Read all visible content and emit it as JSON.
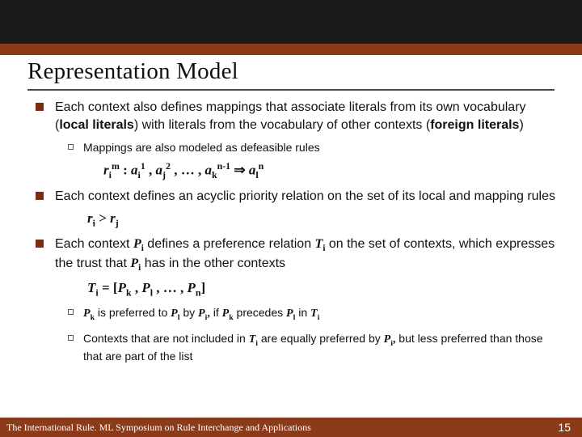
{
  "title": "Representation Model",
  "bullets": {
    "b1a": "Each context also defines mappings that associate literals from its own vocabulary (",
    "b1b": "local literals",
    "b1c": ") with literals from the vocabulary of other contexts (",
    "b1d": "foreign literals",
    "b1e": ")",
    "sub1": "Mappings are also modeled as defeasible rules",
    "b2": "Each context defines an acyclic priority relation on the set of its local and mapping rules",
    "b3a": "Each context ",
    "b3b": " defines a preference relation ",
    "b3c": " on the set of contexts, which expresses the trust that ",
    "b3d": " has in the other contexts",
    "sub2a": " is preferred to ",
    "sub2b": " by ",
    "sub2c": " if ",
    "sub2d": " precedes ",
    "sub2e": " in ",
    "sub3a": "Contexts that are not included in ",
    "sub3b": " are equally preferred by ",
    "sub3c": " but less preferred than those that are part of the list"
  },
  "sym": {
    "Pi": "P",
    "Pk": "P",
    "Pl": "P",
    "Pn": "P",
    "Ti": "T",
    "ri": "r",
    "rj": "r",
    "i": "i",
    "j": "j",
    "k": "k",
    "l": "l",
    "n": "n",
    "m": "m"
  },
  "footer": {
    "text": "The International Rule. ML Symposium on Rule Interchange and Applications",
    "page": "15"
  }
}
